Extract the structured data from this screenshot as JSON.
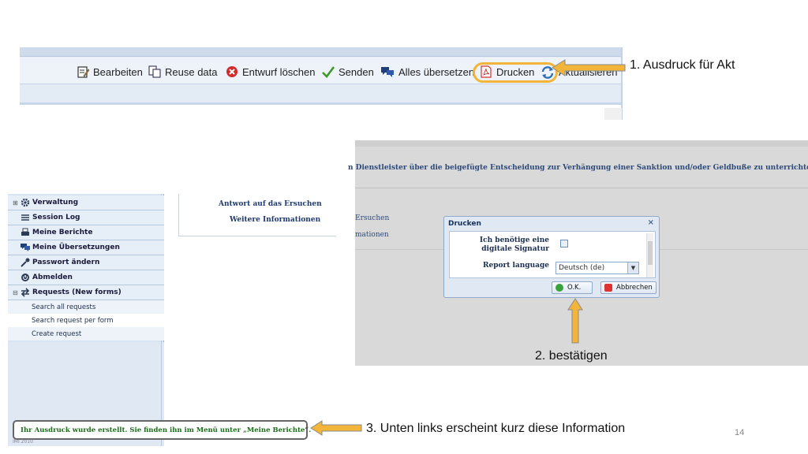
{
  "toolbar": {
    "buttons": [
      {
        "label": "Bearbeiten",
        "icon": "edit-icon"
      },
      {
        "label": "Reuse data",
        "icon": "copy-icon"
      },
      {
        "label": "Entwurf löschen",
        "icon": "delete-icon"
      },
      {
        "label": "Senden",
        "icon": "checkmark-icon"
      },
      {
        "label": "Alles übersetzen",
        "icon": "translate-icon"
      },
      {
        "label": "Drucken",
        "icon": "pdf-icon"
      },
      {
        "label": "Aktualisieren",
        "icon": "refresh-icon"
      }
    ]
  },
  "annotations": {
    "step1": "1. Ausdruck für Akt",
    "step2": "2. bestätigen",
    "step3": "3. Unten links erscheint kurz diese Information",
    "arrow_color": "#f3b43a"
  },
  "sidebar": {
    "items": [
      {
        "label": "Verwaltung",
        "icon": "gear-icon",
        "expandable": true
      },
      {
        "label": "Session Log",
        "icon": "list-icon"
      },
      {
        "label": "Meine Berichte",
        "icon": "printer-icon"
      },
      {
        "label": "Meine Übersetzungen",
        "icon": "chat-icon"
      },
      {
        "label": "Passwort ändern",
        "icon": "key-icon"
      },
      {
        "label": "Abmelden",
        "icon": "power-icon"
      },
      {
        "label": "Requests (New forms)",
        "icon": "exchange-icon",
        "expandable": true
      }
    ],
    "subitems": [
      "Search all requests",
      "Search request per form",
      "Create request"
    ]
  },
  "content_left": {
    "link1": "Antwort auf das Ersuchen",
    "link2": "Weitere Informationen"
  },
  "info_message": "Ihr Ausdruck wurde erstellt. Sie finden ihn im Menü unter „Meine Berichte“.",
  "footer_year": "IMI 2010",
  "main": {
    "heading": "n Dienstleister über die beigefügte Entscheidung zur Verhängung einer Sanktion und/oder Geldbuße zu unterrichten.",
    "link1": "Ersuchen",
    "link2": "mationen"
  },
  "dialog": {
    "title": "Drucken",
    "close": "×",
    "signature_label_line1": "Ich benötige eine",
    "signature_label_line2": "digitale Signatur",
    "language_label": "Report language",
    "language_value": "Deutsch (de)",
    "ok_label": "O.K.",
    "cancel_label": "Abbrechen"
  },
  "page_number": "14"
}
